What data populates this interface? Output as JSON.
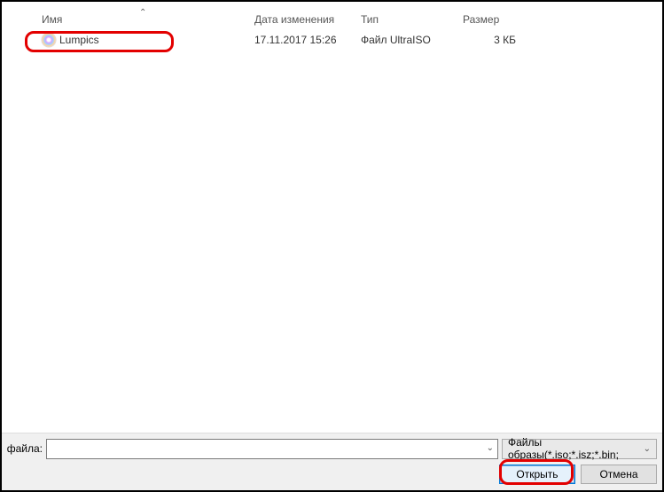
{
  "columns": {
    "name": "Имя",
    "date": "Дата изменения",
    "type": "Тип",
    "size": "Размер"
  },
  "files": [
    {
      "name": "Lumpics",
      "date": "17.11.2017 15:26",
      "type": "Файл UltraISO",
      "size": "3 КБ"
    }
  ],
  "filename_label": "файла:",
  "filename_value": "",
  "filetype_label": "Файлы образы(*.iso;*.isz;*.bin;",
  "buttons": {
    "open": "Открыть",
    "cancel": "Отмена"
  }
}
